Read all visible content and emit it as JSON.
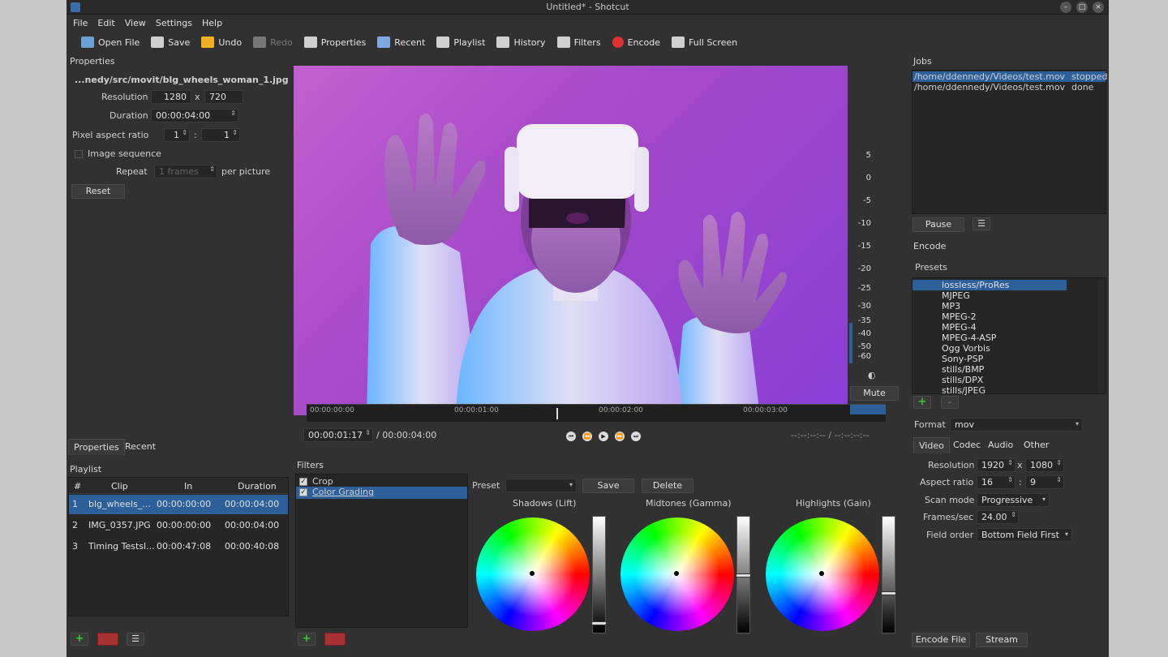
{
  "window": {
    "title": "Untitled* - Shotcut"
  },
  "menu": [
    "File",
    "Edit",
    "View",
    "Settings",
    "Help"
  ],
  "toolbar": [
    {
      "label": "Open File",
      "icon": "folder-icon",
      "color": "#6aa0d8",
      "disabled": false
    },
    {
      "label": "Save",
      "icon": "save-icon",
      "color": "#cfcfcf",
      "disabled": false
    },
    {
      "label": "Undo",
      "icon": "undo-icon",
      "color": "#f0b020",
      "disabled": false
    },
    {
      "label": "Redo",
      "icon": "redo-icon",
      "color": "#777777",
      "disabled": true
    },
    {
      "label": "Properties",
      "icon": "properties-icon",
      "color": "#d0d0d0",
      "disabled": false
    },
    {
      "label": "Recent",
      "icon": "recent-icon",
      "color": "#80a8e0",
      "disabled": false
    },
    {
      "label": "Playlist",
      "icon": "playlist-icon",
      "color": "#d0d0d0",
      "disabled": false
    },
    {
      "label": "History",
      "icon": "history-icon",
      "color": "#d0d0d0",
      "disabled": false
    },
    {
      "label": "Filters",
      "icon": "filters-icon",
      "color": "#d0d0d0",
      "disabled": false
    },
    {
      "label": "Encode",
      "icon": "encode-icon",
      "color": "#e03030",
      "disabled": false
    },
    {
      "label": "Full Screen",
      "icon": "fullscreen-icon",
      "color": "#d0d0d0",
      "disabled": false
    }
  ],
  "properties": {
    "title": "Properties",
    "filename": "...nedy/src/movit/blg_wheels_woman_1.jpg",
    "resolution_label": "Resolution",
    "res_w": "1280",
    "res_x": "x",
    "res_h": "720",
    "duration_label": "Duration",
    "duration": "00:00:04:00",
    "par_label": "Pixel aspect ratio",
    "par_a": "1",
    "par_sep": ":",
    "par_b": "1",
    "image_seq": "Image sequence",
    "repeat_label": "Repeat",
    "repeat_value": "1 frames",
    "per_picture": "per picture",
    "reset": "Reset",
    "tabs": [
      "Properties",
      "Recent"
    ]
  },
  "playlist": {
    "title": "Playlist",
    "headers": [
      "#",
      "Clip",
      "In",
      "Duration"
    ],
    "rows": [
      [
        "1",
        "blg_wheels_...",
        "00:00:00:00",
        "00:00:04:00"
      ],
      [
        "2",
        "IMG_0357.JPG",
        "00:00:00:00",
        "00:00:04:00"
      ],
      [
        "3",
        "Timing Testsl...",
        "00:00:47:08",
        "00:00:40:08"
      ]
    ]
  },
  "player": {
    "ruler": [
      "00:00:00:00",
      "00:00:01:00",
      "00:00:02:00",
      "00:00:03:00"
    ],
    "position": "00:00:01:17",
    "duration": "/ 00:00:04:00",
    "inout": "--:--:--:-- / --:--:--:--",
    "mute": "Mute",
    "meter": [
      "5",
      "0",
      "-5",
      "-10",
      "-15",
      "-20",
      "-25",
      "-30",
      "-35",
      "-40",
      "-50",
      "-60"
    ]
  },
  "filters": {
    "title": "Filters",
    "items": [
      {
        "label": "Crop",
        "checked": true
      },
      {
        "label": "Color Grading",
        "checked": true
      }
    ],
    "preset_label": "Preset",
    "save": "Save",
    "delete": "Delete",
    "wheels": [
      {
        "label": "Shadows (Lift)",
        "level": 0.93
      },
      {
        "label": "Midtones (Gamma)",
        "level": 0.5
      },
      {
        "label": "Highlights (Gain)",
        "level": 0.66
      }
    ]
  },
  "jobs": {
    "title": "Jobs",
    "items": [
      {
        "path": "/home/ddennedy/Videos/test.mov",
        "status": "stopped"
      },
      {
        "path": "/home/ddennedy/Videos/test.mov",
        "status": "done"
      }
    ],
    "pause": "Pause"
  },
  "encode": {
    "title": "Encode",
    "presets_label": "Presets",
    "presets": [
      "lossless/ProRes",
      "MJPEG",
      "MP3",
      "MPEG-2",
      "MPEG-4",
      "MPEG-4-ASP",
      "Ogg Vorbis",
      "Sony-PSP",
      "stills/BMP",
      "stills/DPX",
      "stills/JPEG"
    ],
    "format_label": "Format",
    "format": "mov",
    "tabs": [
      "Video",
      "Codec",
      "Audio",
      "Other"
    ],
    "resolution_label": "Resolution",
    "res_w": "1920",
    "res_x": "x",
    "res_h": "1080",
    "aspect_label": "Aspect ratio",
    "asp_a": "16",
    "asp_sep": ":",
    "asp_b": "9",
    "scan_label": "Scan mode",
    "scan": "Progressive",
    "fps_label": "Frames/sec",
    "fps": "24.00",
    "field_label": "Field order",
    "field": "Bottom Field First",
    "encode_file": "Encode File",
    "stream": "Stream"
  },
  "colors": {
    "accent": "#2d5f9a",
    "selected_row": "#2d5f9a",
    "wheel_bg": "#1f1f1f"
  }
}
